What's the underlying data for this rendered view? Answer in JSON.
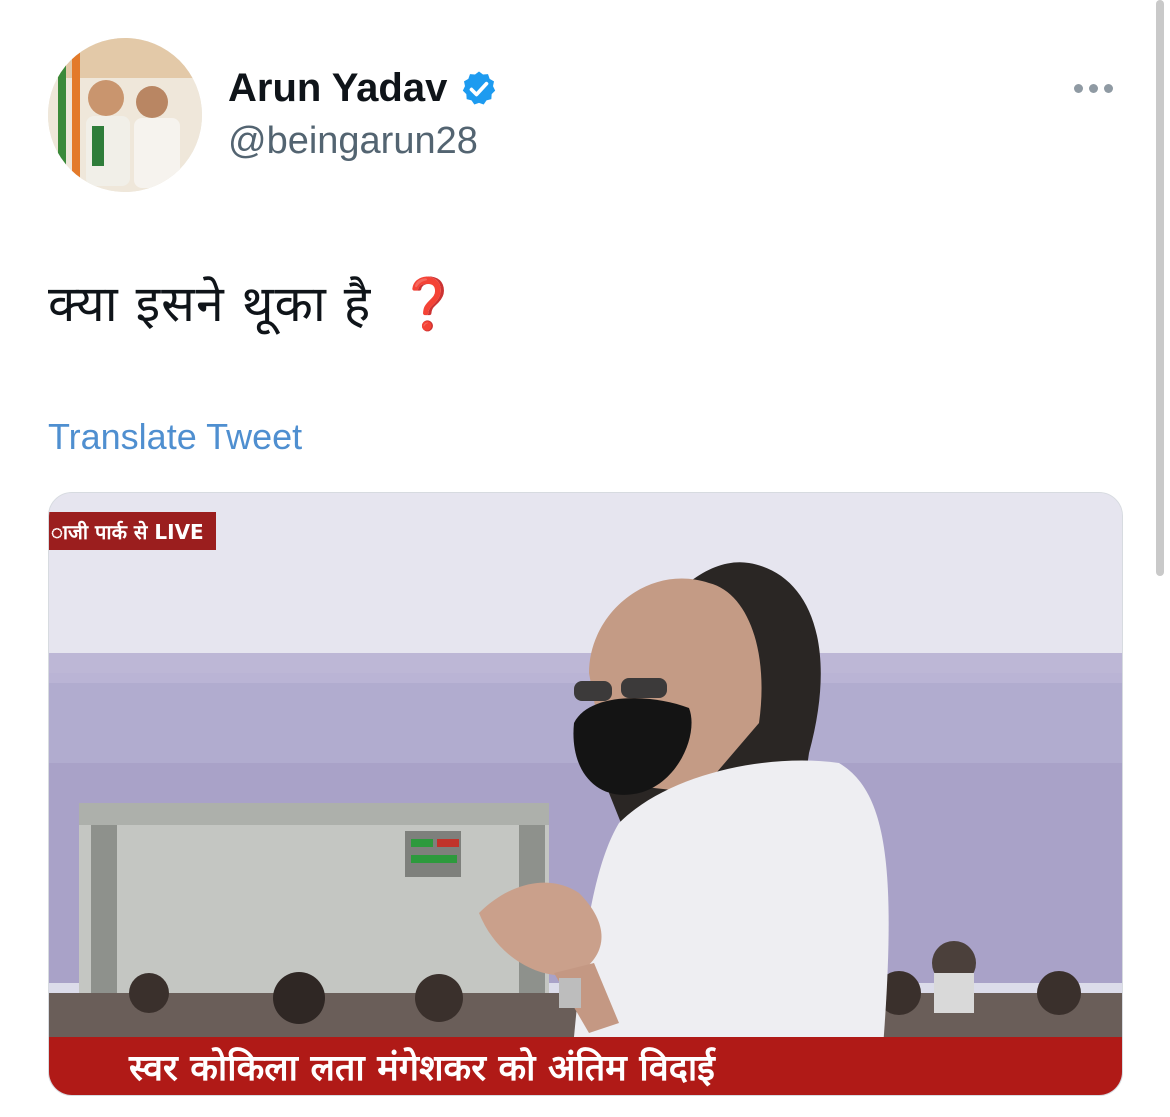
{
  "author": {
    "name": "Arun Yadav",
    "handle": "@beingarun28",
    "verified": true,
    "verified_color": "#1d9bf0"
  },
  "tweet": {
    "text": "क्या इसने थूका है",
    "emoji": "❓",
    "translate_label": "Translate Tweet",
    "link_color": "#4f8fd0"
  },
  "media": {
    "live_badge": "ाजी पार्क से LIVE",
    "ticker_text": "स्वर कोकिला लता मंगेशकर को अंतिम विदाई"
  },
  "icons": {
    "more": "more-dots-icon",
    "verified": "verified-badge-icon"
  }
}
